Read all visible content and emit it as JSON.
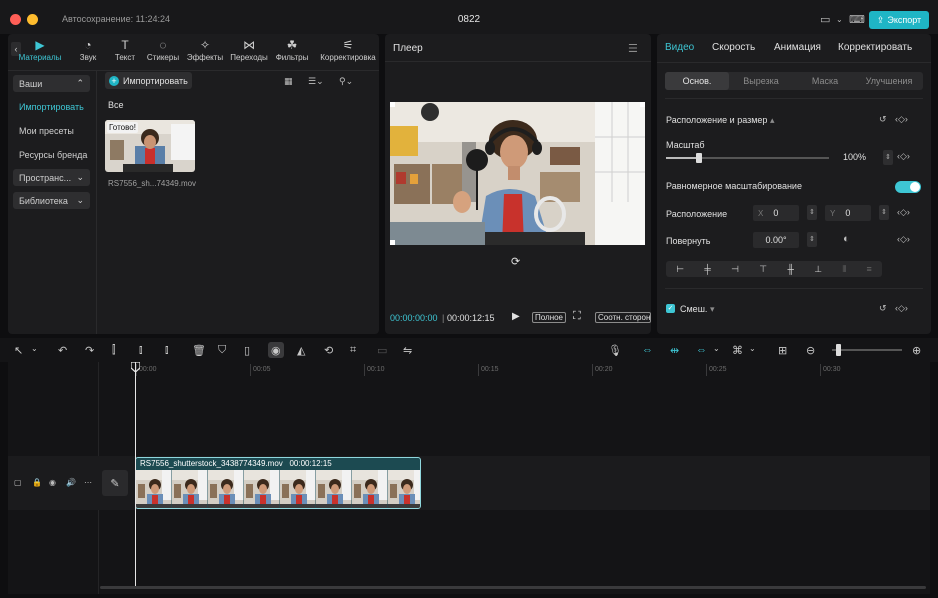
{
  "titlebar": {
    "autosave": "Автосохранение: 11:24:24",
    "project_title": "0822",
    "export_label": "Экспорт"
  },
  "media_tabs": [
    {
      "label": "Материалы",
      "icon": "media-icon",
      "active": true
    },
    {
      "label": "Звук",
      "icon": "audio-icon"
    },
    {
      "label": "Текст",
      "icon": "text-icon"
    },
    {
      "label": "Стикеры",
      "icon": "sticker-icon"
    },
    {
      "label": "Эффекты",
      "icon": "effects-icon"
    },
    {
      "label": "Переходы",
      "icon": "transitions-icon"
    },
    {
      "label": "Фильтры",
      "icon": "filters-icon"
    },
    {
      "label": "Корректировка",
      "icon": "adjust-icon"
    }
  ],
  "media_sidebar": {
    "yours": "Ваши",
    "import": "Импортировать",
    "presets": "Мои пресеты",
    "brand": "Ресурсы бренда",
    "spaces": "Пространс...",
    "library": "Библиотека"
  },
  "media": {
    "import_button": "Импортировать",
    "all_label": "Все",
    "clip_badge": "Готово!",
    "clip_name": "RS7556_sh...74349.mov"
  },
  "player": {
    "title": "Плеер",
    "time_current": "00:00:00:00",
    "time_separator": "|",
    "time_total": "00:00:12:15",
    "full_label": "Полное",
    "ratio_label": "Соотн. сторон"
  },
  "inspector": {
    "tabs": [
      "Видео",
      "Скорость",
      "Анимация",
      "Корректировать"
    ],
    "subtabs": [
      "Основ.",
      "Вырезка",
      "Маска",
      "Улучшения"
    ],
    "section_position": "Расположение и размер",
    "scale_label": "Масштаб",
    "scale_value": "100%",
    "scale_fraction": 0.2,
    "uniform_label": "Равномерное масштабирование",
    "position_label": "Расположение",
    "pos_x_axis": "X",
    "pos_x": "0",
    "pos_y_axis": "Y",
    "pos_y": "0",
    "rotate_label": "Повернуть",
    "rotate_value": "0.00°",
    "blend_label": "Смеш."
  },
  "timeline": {
    "ruler": [
      "00:00",
      "00:05",
      "00:10",
      "00:15",
      "00:20",
      "00:25",
      "00:30"
    ],
    "clip_name": "RS7556_shutterstock_3438774349.mov",
    "clip_duration": "00:00:12:15"
  }
}
